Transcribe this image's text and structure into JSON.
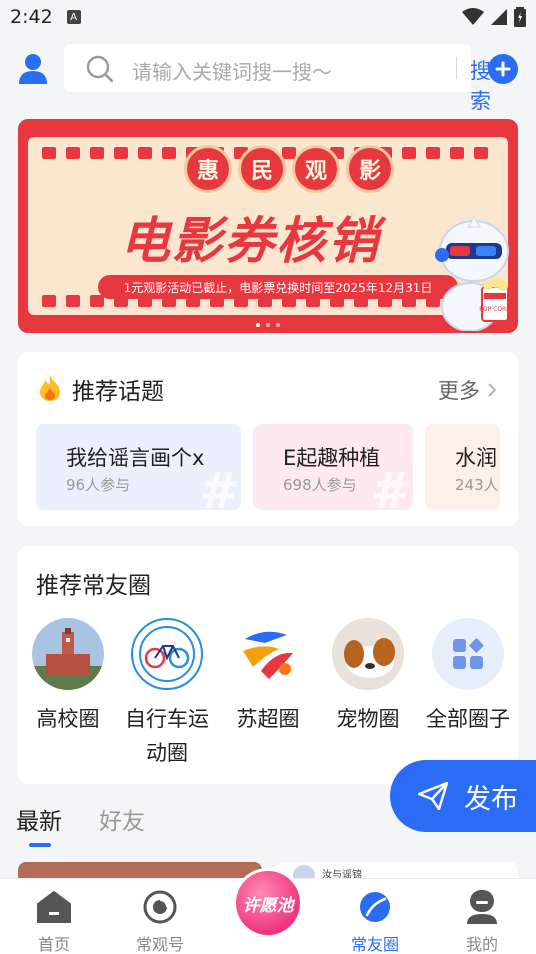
{
  "status_bar": {
    "time": "2:42",
    "notification_icon": "a-icon"
  },
  "search": {
    "placeholder": "请输入关键词搜一搜～",
    "button_label": "搜索"
  },
  "banner": {
    "badges": [
      "惠",
      "民",
      "观",
      "影"
    ],
    "headline": "电影券核销",
    "subtitle": "1元观影活动已截止，电影票兑换时间至2025年12月31日",
    "mascot_popcorn": "POP CORN",
    "page_count": 3,
    "active_page": 1
  },
  "topics": {
    "title": "推荐话题",
    "more_label": "更多",
    "items": [
      {
        "title": "我给谣言画个x",
        "count": "96人参与",
        "bg": "#eaf0fd"
      },
      {
        "title": "E起趣种植",
        "count": "698人参与",
        "bg": "#fdeaf1"
      },
      {
        "title": "水润",
        "count": "243人",
        "bg": "#fdf0e8"
      }
    ]
  },
  "circles": {
    "title": "推荐常友圈",
    "items": [
      {
        "label": "高校圈"
      },
      {
        "label": "自行车运动圈"
      },
      {
        "label": "苏超圈"
      },
      {
        "label": "宠物圈"
      },
      {
        "label": "全部圈子"
      }
    ]
  },
  "feed_tabs": {
    "latest": "最新",
    "friends": "好友"
  },
  "publish_label": "发布",
  "feed_peek": {
    "author": "汝与谣锦"
  },
  "bottom_nav": {
    "home": "首页",
    "channel": "常观号",
    "wish": "许愿池",
    "circle": "常友圈",
    "mine": "我的"
  },
  "colors": {
    "accent": "#2a6df4",
    "banner_red": "#e8383f",
    "wish_pink": "#f0357c"
  }
}
